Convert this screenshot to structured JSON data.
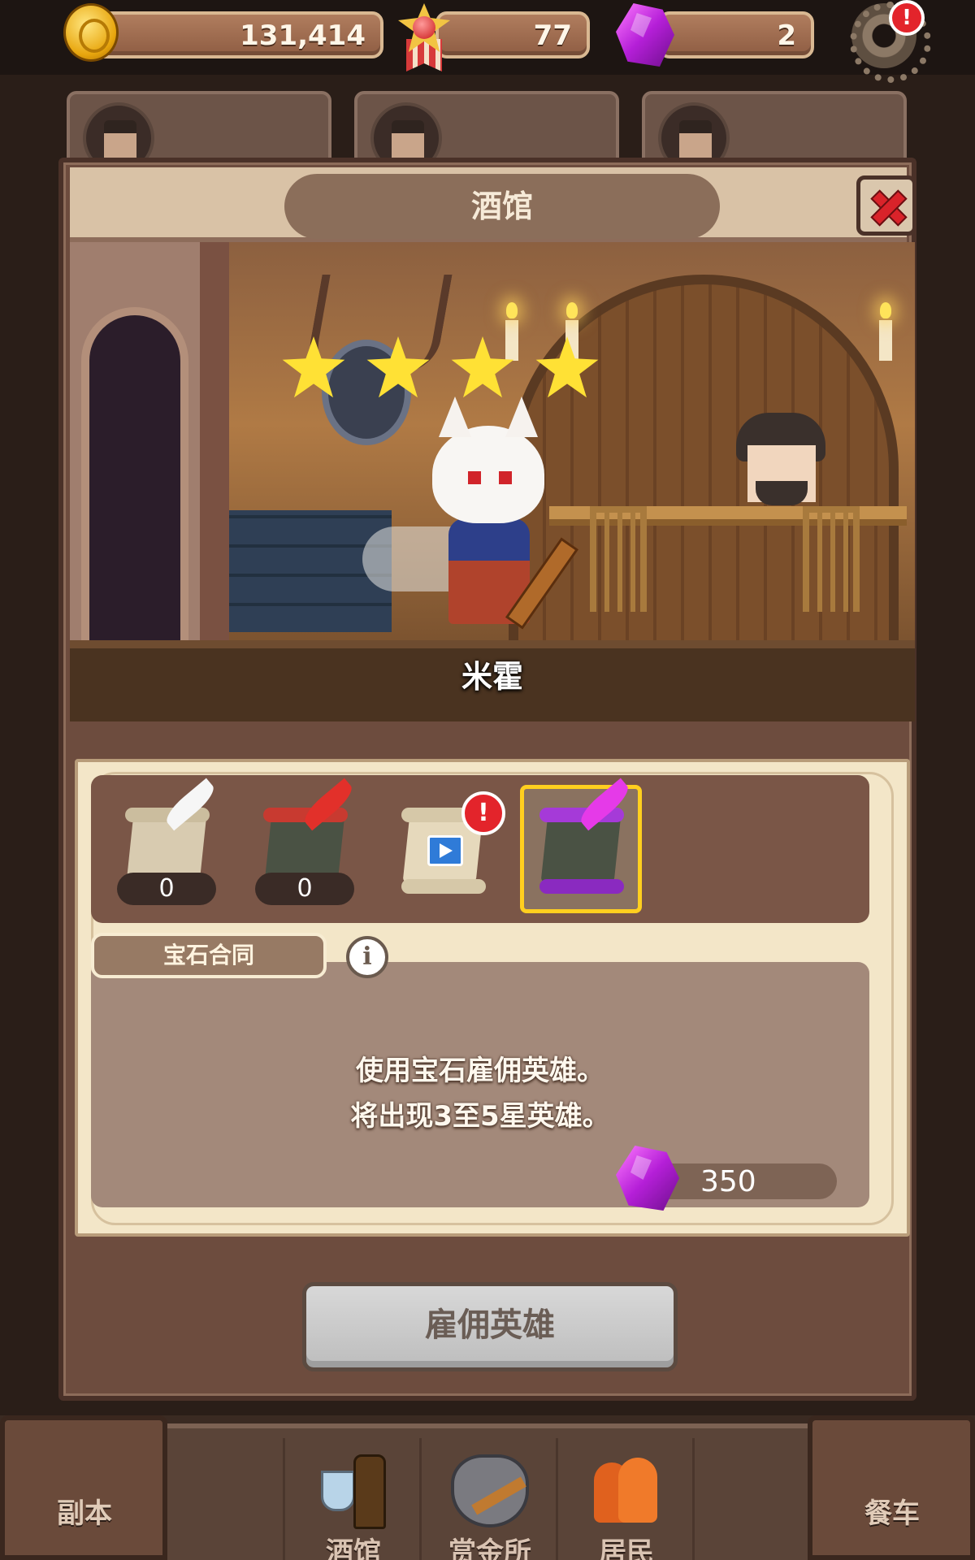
{
  "currency": {
    "gold": "131,414",
    "medals": "77",
    "gems": "2",
    "settings_alert": "!"
  },
  "panel": {
    "title": "酒馆"
  },
  "scene": {
    "hero_name": "米霍",
    "star_count": 4
  },
  "scrolls": {
    "items": [
      {
        "name": "white-quill-scroll",
        "count": "0"
      },
      {
        "name": "red-quill-scroll",
        "count": "0"
      },
      {
        "name": "video-ticket-scroll",
        "alert": "!"
      },
      {
        "name": "purple-quill-scroll",
        "selected": true
      }
    ]
  },
  "contract": {
    "tab_label": "宝石合同",
    "info": "i",
    "line1": "使用宝石雇佣英雄。",
    "line2": "将出现3至5星英雄。",
    "cost": "350"
  },
  "hire_button": "雇佣英雄",
  "nav": {
    "dungeon": "副本",
    "tavern": "酒馆",
    "bounty": "赏金所",
    "residents": "居民",
    "dining_car": "餐车"
  },
  "colors": {
    "selected_border": "#ffcf1f",
    "alert": "#e3242b",
    "gem": "#b51fd8",
    "star": "#ffe135"
  }
}
